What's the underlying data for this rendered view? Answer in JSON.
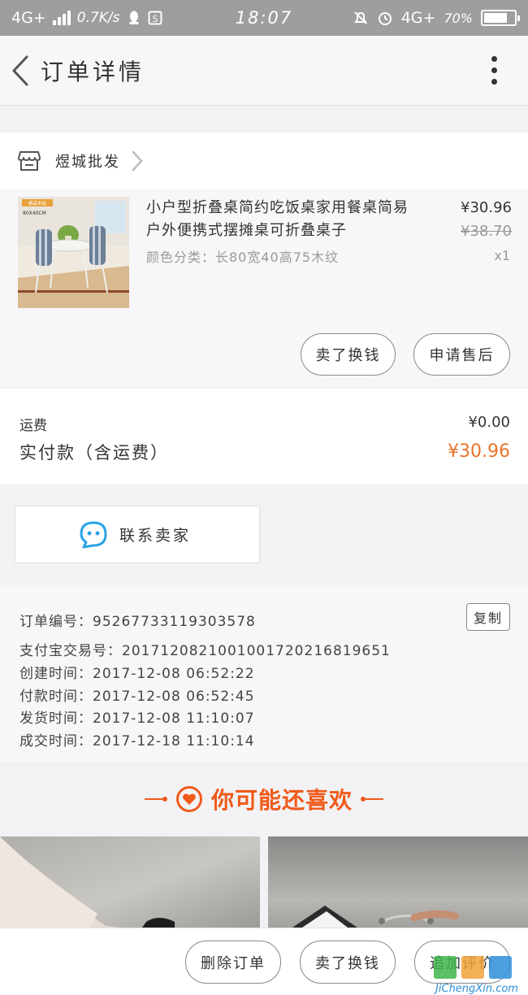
{
  "status_bar": {
    "network": "4G+",
    "speed": "0.7K/s",
    "time": "18:07",
    "network_right": "4G+",
    "battery": "70%"
  },
  "nav": {
    "title": "订单详情",
    "back_icon": "chevron-left-icon",
    "more_icon": "more-vertical-icon"
  },
  "shop": {
    "name": "煜城批发",
    "icon": "store-icon"
  },
  "product": {
    "title": "小户型折叠桌简约吃饭桌家用餐桌简易户外便携式摆摊桌可折叠桌子",
    "spec": "颜色分类：长80宽40高75木纹",
    "price": "¥30.96",
    "original_price": "¥38.70",
    "quantity": "x1",
    "image_badge": "精品木纹",
    "image_size_label": "80X40CM",
    "remind_button": "卖了换钱",
    "service_button": "申请售后"
  },
  "fees": {
    "shipping_label": "运费",
    "shipping_value": "¥0.00",
    "paid_label": "实付款（含运费）",
    "paid_value": "¥30.96"
  },
  "contact": {
    "label": "联系卖家",
    "icon": "chat-bubble-icon"
  },
  "order_info": {
    "lines": [
      "订单编号：95267733119303578",
      "支付宝交易号：2017120821001001720216819651",
      "创建时间：2017-12-08 06:52:22",
      "付款时间：2017-12-08 06:52:45",
      "发货时间：2017-12-08 11:10:07",
      "成交时间：2017-12-18 11:10:14"
    ],
    "copy_button": "复制"
  },
  "recommend": {
    "title": "你可能还喜欢",
    "icon": "heart-icon"
  },
  "bottom_bar": {
    "delete_button": "删除订单",
    "sell_button": "卖了换钱",
    "review_button": "追加评价"
  },
  "watermark": {
    "text": "JiChengXin.com"
  },
  "colors": {
    "accent": "#f05a1a",
    "price_orange": "#e8742b",
    "status_bar": "#9e9e9e",
    "chat_blue": "#2aa3e6"
  }
}
